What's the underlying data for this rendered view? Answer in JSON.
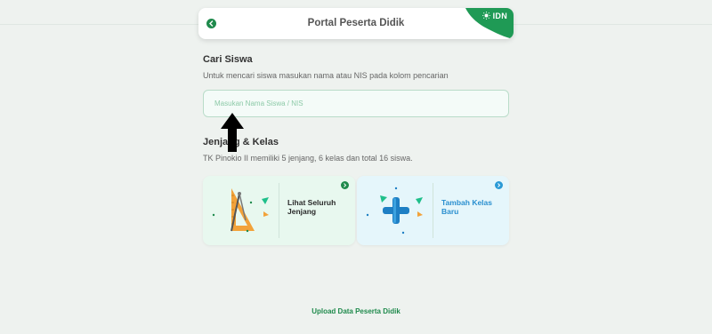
{
  "header": {
    "title": "Portal Peserta Didik",
    "brand": "IDN",
    "brand_color": "#1f9a55"
  },
  "search_section": {
    "title": "Cari Siswa",
    "description": "Untuk mencari siswa masukan nama atau NIS pada kolom pencarian",
    "placeholder": "Masukan Nama Siswa / NIS"
  },
  "class_section": {
    "title": "Jenjang & Kelas",
    "description": "TK Pinokio II memiliki 5 jenjang, 6 kelas dan total 16 siswa."
  },
  "cards": [
    {
      "label": "Lihat Seluruh Jenjang",
      "icon": "ruler-triangle-icon",
      "accent": "#1f8a4c"
    },
    {
      "label": "Tambah Kelas Baru",
      "icon": "plus-icon",
      "accent": "#2a9ad6"
    }
  ],
  "footer": {
    "upload_label": "Upload Data Peserta Didik"
  }
}
